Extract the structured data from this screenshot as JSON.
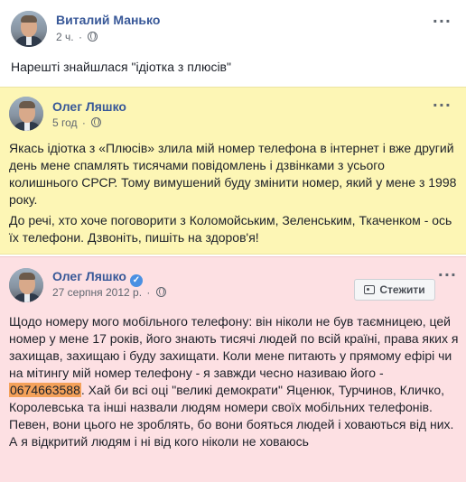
{
  "post": {
    "author": "Виталий Манько",
    "time": "2 ч.",
    "caption": "Нарешті знайшлася \"ідіотка з плюсів\""
  },
  "card1": {
    "author": "Олег Ляшко",
    "time": "5 год",
    "para1": "Якась ідіотка з «Плюсів» злила мій номер телефона в інтернет і вже другий день мене спамлять тисячами повідомлень і дзвінками з усього колишнього СРСР. Тому вимушений буду змінити номер, який у мене з 1998 року.",
    "para2": "До речі, хто хоче поговорити з Коломойським, Зеленським, Ткаченком - ось їх телефони. Дзвоніть, пишіть на здоров'я!"
  },
  "card2": {
    "author": "Олег Ляшко",
    "date": "27 серпня 2012 р.",
    "follow_label": "Стежити",
    "text_before": "Щодо номеру мого мобільного телефону: він ніколи не був таємницею, цей номер у мене 17 років, його знають тисячі людей по всій країні, права яких я захищав, захищаю і буду захищати. Коли мене питають у прямому ефірі чи на мітингу мій номер телефону - я завжди чесно називаю його - ",
    "phone": "0674663588",
    "text_after": ". Хай би всі оці \"великі демократи\" Яценюк, Турчинов, Кличко, Королевська та інші назвали людям номери своїх мобільних телефонів. Певен, вони цього не зроблять, бо вони бояться людей і ховаються від них. А я відкритий людям і ні від кого ніколи не ховаюсь"
  }
}
